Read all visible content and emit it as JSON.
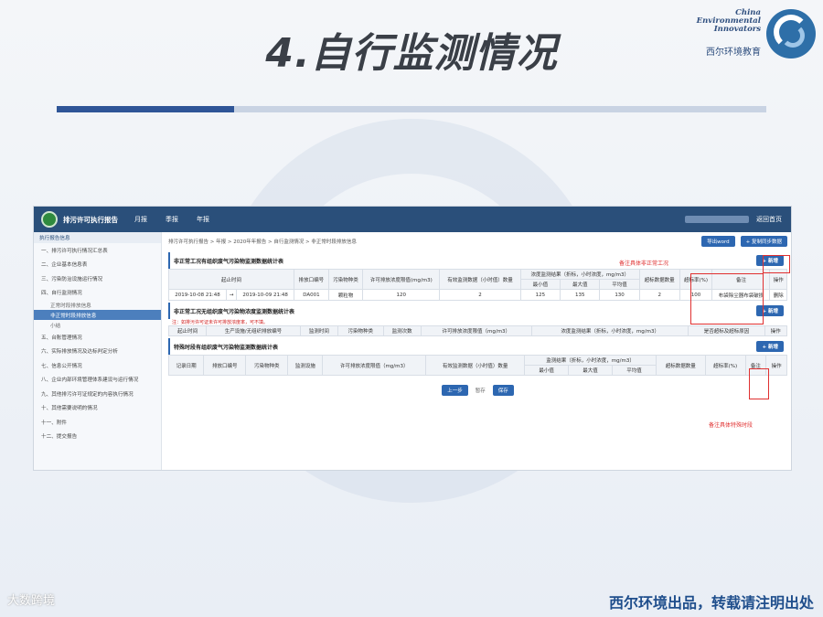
{
  "slide": {
    "title": "4.自行监测情况",
    "logo_line1": "China",
    "logo_line2": "Environmental",
    "logo_line3": "Innovators",
    "logo_cn": "西尔环境教育",
    "footer_left": "大数跨境",
    "footer_right": "西尔环境出品，转载请注明出处"
  },
  "app": {
    "system_name": "排污许可执行报告",
    "nav": [
      "月报",
      "季报",
      "年报"
    ],
    "back_label": "返回首页",
    "sidebar_head": "执行报告信息",
    "sidebar_items": [
      "一、排污许可执行情况汇总表",
      "二、企业基本信息表",
      "三、污染防治设施运行情况",
      "四、自行监测情况",
      "正常时段排放信息",
      "非正常时段排放信息",
      "小结",
      "五、台账管理情况",
      "六、实际排放情况及达标判定分析",
      "七、信息公开情况",
      "八、企业内部环境管理体系建设与运行情况",
      "九、其他排污许可证规定的内容执行情况",
      "十、其他需要说明的情况",
      "十一、附件",
      "十二、提交报告"
    ],
    "breadcrumb": "排污许可执行报告 > 年报 > 2020年年报告 > 自行监测情况 > 非正常时段排放信息",
    "export_label": "导出word",
    "copy_label": "+ 复制同步数据",
    "add_label": "+ 新增",
    "section1_title": "非正常工况有组织废气污染物监测数据统计表",
    "section2_title": "非正常工况无组织废气污染物浓度监测数据统计表",
    "section2_note": "注：如排污许可证未许可排放浓度率，可不填。",
    "section3_title": "特殊时段有组织废气污染物监测数据统计表",
    "table1": {
      "headers": [
        "起止时间",
        "排放口编号",
        "污染物种类",
        "许可排放浓度限值(mg/m3)",
        "有效监测数据（小时值）数量",
        "浓度监测结果（折标，小时浓度，mg/m3）",
        "超标数据数量",
        "超标率(%)",
        "备注",
        "操作"
      ],
      "sub_headers": [
        "最小值",
        "最大值",
        "平均值"
      ],
      "row": {
        "start": "2019-10-08 21:48",
        "sep": "→",
        "end": "2019-10-09 21:48",
        "outlet": "DA001",
        "pollutant": "颗粒物",
        "limit": "120",
        "count": "2",
        "min": "125",
        "max": "135",
        "avg": "130",
        "exceed_count": "2",
        "exceed_rate": "100",
        "remark": "布袋除尘器布袋破损",
        "action": "删除"
      }
    },
    "table2": {
      "headers": [
        "起止时间",
        "生产设施/无组织排放编号",
        "监测时间",
        "污染物种类",
        "监测次数",
        "许可排放浓度限值（mg/m3）",
        "浓度监测结果（折标，小时浓度，mg/m3）",
        "是否超标及超标原因",
        "操作"
      ]
    },
    "table3": {
      "headers": [
        "记录日期",
        "排放口编号",
        "污染物种类",
        "监测设施",
        "许可排放浓度限值（mg/m3）",
        "有效监测数据（小时值）数量",
        "监测结果（折标，小时浓度，mg/m3）",
        "超标数据数量",
        "超标率(%)",
        "备注",
        "操作"
      ],
      "sub_headers": [
        "最小值",
        "最大值",
        "平均值"
      ]
    },
    "pager": {
      "prev": "上一步",
      "status": "暂存",
      "save": "保存"
    }
  },
  "annotations": {
    "note1": "备注具体非正常工况",
    "note2": "备注具体特殊时段"
  },
  "colors": {
    "accent": "#2d67b1",
    "topbar": "#2a4f7a",
    "annotation": "#e03030"
  }
}
